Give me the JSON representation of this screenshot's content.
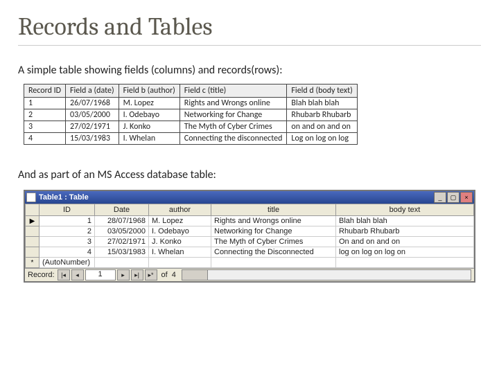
{
  "title": "Records and Tables",
  "caption1": "A simple table showing fields (columns) and records(rows):",
  "caption2": "And as part of an MS Access database table:",
  "simple_table": {
    "headers": [
      "Record ID",
      "Field a (date)",
      "Field b (author)",
      "Field c (title)",
      "Field d (body text)"
    ],
    "rows": [
      [
        "1",
        "26/07/1968",
        "M. Lopez",
        "Rights and Wrongs online",
        "Blah blah blah"
      ],
      [
        "2",
        "03/05/2000",
        "I. Odebayo",
        "Networking for Change",
        "Rhubarb Rhubarb"
      ],
      [
        "3",
        "27/02/1971",
        "J. Konko",
        "The Myth of Cyber Crimes",
        "on and on and on"
      ],
      [
        "4",
        "15/03/1983",
        "I. Whelan",
        "Connecting the disconnected",
        "Log on log on log"
      ]
    ]
  },
  "access": {
    "window_title": "Table1 : Table",
    "columns": [
      "ID",
      "Date",
      "author",
      "title",
      "body text"
    ],
    "rows": [
      {
        "pointer": "▶",
        "id": "1",
        "date": "28/07/1968",
        "author": "M. Lopez",
        "title": "Rights and Wrongs online",
        "body": "Blah blah blah"
      },
      {
        "pointer": "",
        "id": "2",
        "date": "03/05/2000",
        "author": "I. Odebayo",
        "title": "Networking for Change",
        "body": "Rhubarb Rhubarb"
      },
      {
        "pointer": "",
        "id": "3",
        "date": "27/02/1971",
        "author": "J. Konko",
        "title": "The Myth of Cyber Crimes",
        "body": "On and on and on"
      },
      {
        "pointer": "",
        "id": "4",
        "date": "15/03/1983",
        "author": "I. Whelan",
        "title": "Connecting the Disconnected",
        "body": "log on log on log on"
      }
    ],
    "new_row": {
      "pointer": "*",
      "id": "(AutoNumber)",
      "date": "",
      "author": "",
      "title": "",
      "body": ""
    },
    "nav": {
      "label": "Record:",
      "first": "|◂",
      "prev": "◂",
      "current": "1",
      "next": "▸",
      "last": "▸|",
      "new": "▸*",
      "of_label": "of",
      "total": "4"
    }
  }
}
